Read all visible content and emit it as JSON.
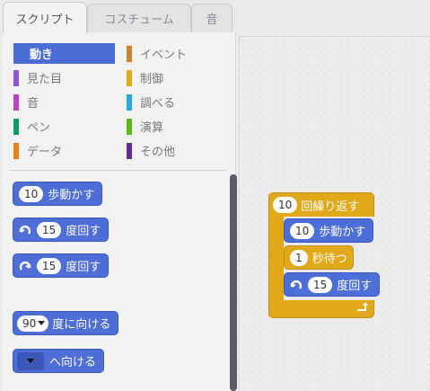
{
  "tabs": [
    {
      "label": "スクリプト",
      "active": true
    },
    {
      "label": "コスチューム",
      "active": false
    },
    {
      "label": "音",
      "active": false
    }
  ],
  "categories": [
    {
      "label": "動き",
      "color": "#4a6cd4",
      "selected": true
    },
    {
      "label": "イベント",
      "color": "#c88330",
      "selected": false
    },
    {
      "label": "見た目",
      "color": "#8a55d7",
      "selected": false
    },
    {
      "label": "制御",
      "color": "#e1a91a",
      "selected": false
    },
    {
      "label": "音",
      "color": "#bb42c3",
      "selected": false
    },
    {
      "label": "調べる",
      "color": "#2ca5e2",
      "selected": false
    },
    {
      "label": "ペン",
      "color": "#0e9a6c",
      "selected": false
    },
    {
      "label": "演算",
      "color": "#5cb712",
      "selected": false
    },
    {
      "label": "データ",
      "color": "#ee7d16",
      "selected": false
    },
    {
      "label": "その他",
      "color": "#632d99",
      "selected": false
    }
  ],
  "palette_blocks": {
    "move": {
      "value": "10",
      "label": "歩動かす"
    },
    "turn_right": {
      "icon": "rotate-clockwise-icon",
      "value": "15",
      "label": "度回す"
    },
    "turn_left": {
      "icon": "rotate-counterclockwise-icon",
      "value": "15",
      "label": "度回す"
    },
    "point_direction": {
      "value": "90",
      "label": "度に向ける"
    },
    "point_towards": {
      "label": "へ向ける"
    }
  },
  "script": {
    "repeat": {
      "value": "10",
      "label": "回繰り返す",
      "icon": "loop-arrow-icon"
    },
    "move": {
      "value": "10",
      "label": "歩動かす"
    },
    "wait": {
      "value": "1",
      "label": "秒待つ"
    },
    "turn": {
      "icon": "rotate-clockwise-icon",
      "value": "15",
      "label": "度回す"
    }
  }
}
